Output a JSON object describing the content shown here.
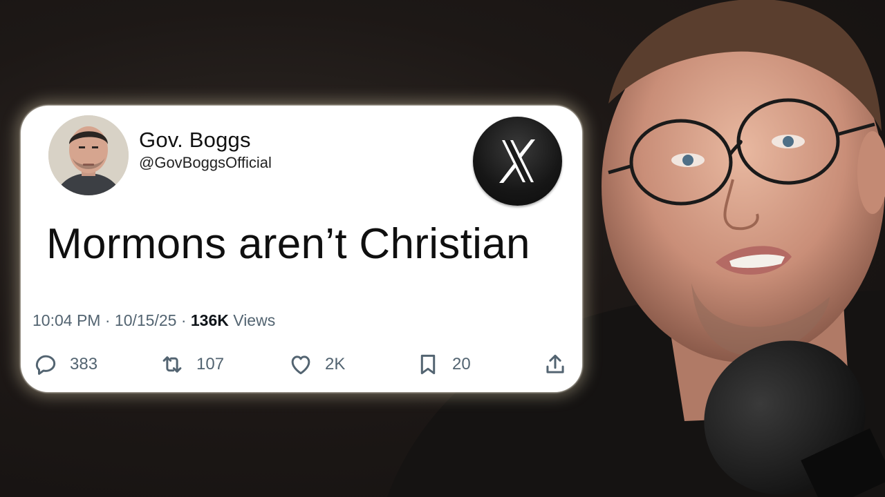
{
  "tweet": {
    "author": {
      "name": "Gov. Boggs",
      "handle": "@GovBoggsOfficial"
    },
    "platform_logo": "x-logo-icon",
    "text": "Mormons aren’t Christian",
    "time": "10:04 PM",
    "date": "10/15/25",
    "views_count": "136K",
    "views_label": "Views",
    "separator": "·",
    "stats": {
      "replies": "383",
      "reposts": "107",
      "likes": "2K",
      "bookmarks": "20"
    },
    "icons": {
      "reply": "reply-icon",
      "repost": "repost-icon",
      "like": "heart-icon",
      "bookmark": "bookmark-icon",
      "share": "share-icon"
    }
  },
  "colors": {
    "card_background": "#ffffff",
    "meta_text": "#536471",
    "tweet_text": "#0f0f0f",
    "background": "#1d1816"
  }
}
